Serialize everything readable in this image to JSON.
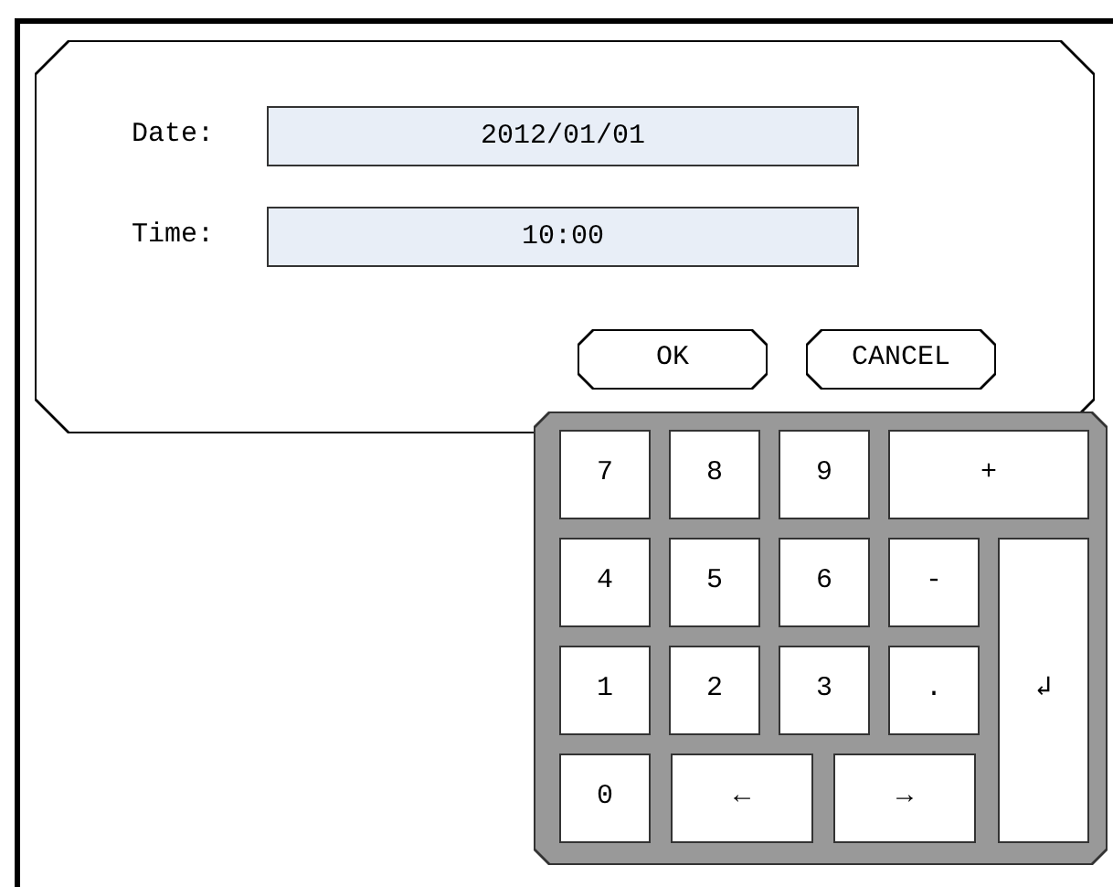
{
  "form": {
    "fields": [
      {
        "label": "Date:",
        "value": "2012/01/01"
      },
      {
        "label": "Time:",
        "value": "10:00"
      }
    ],
    "buttons": [
      "OK",
      "CANCEL"
    ]
  },
  "keypad": {
    "rows": [
      [
        "7",
        "8",
        "9",
        "+"
      ],
      [
        "4",
        "5",
        "6",
        "-"
      ],
      [
        "1",
        "2",
        "3",
        "."
      ],
      [
        "0",
        "←",
        "→"
      ]
    ],
    "enter_key": "↲"
  }
}
